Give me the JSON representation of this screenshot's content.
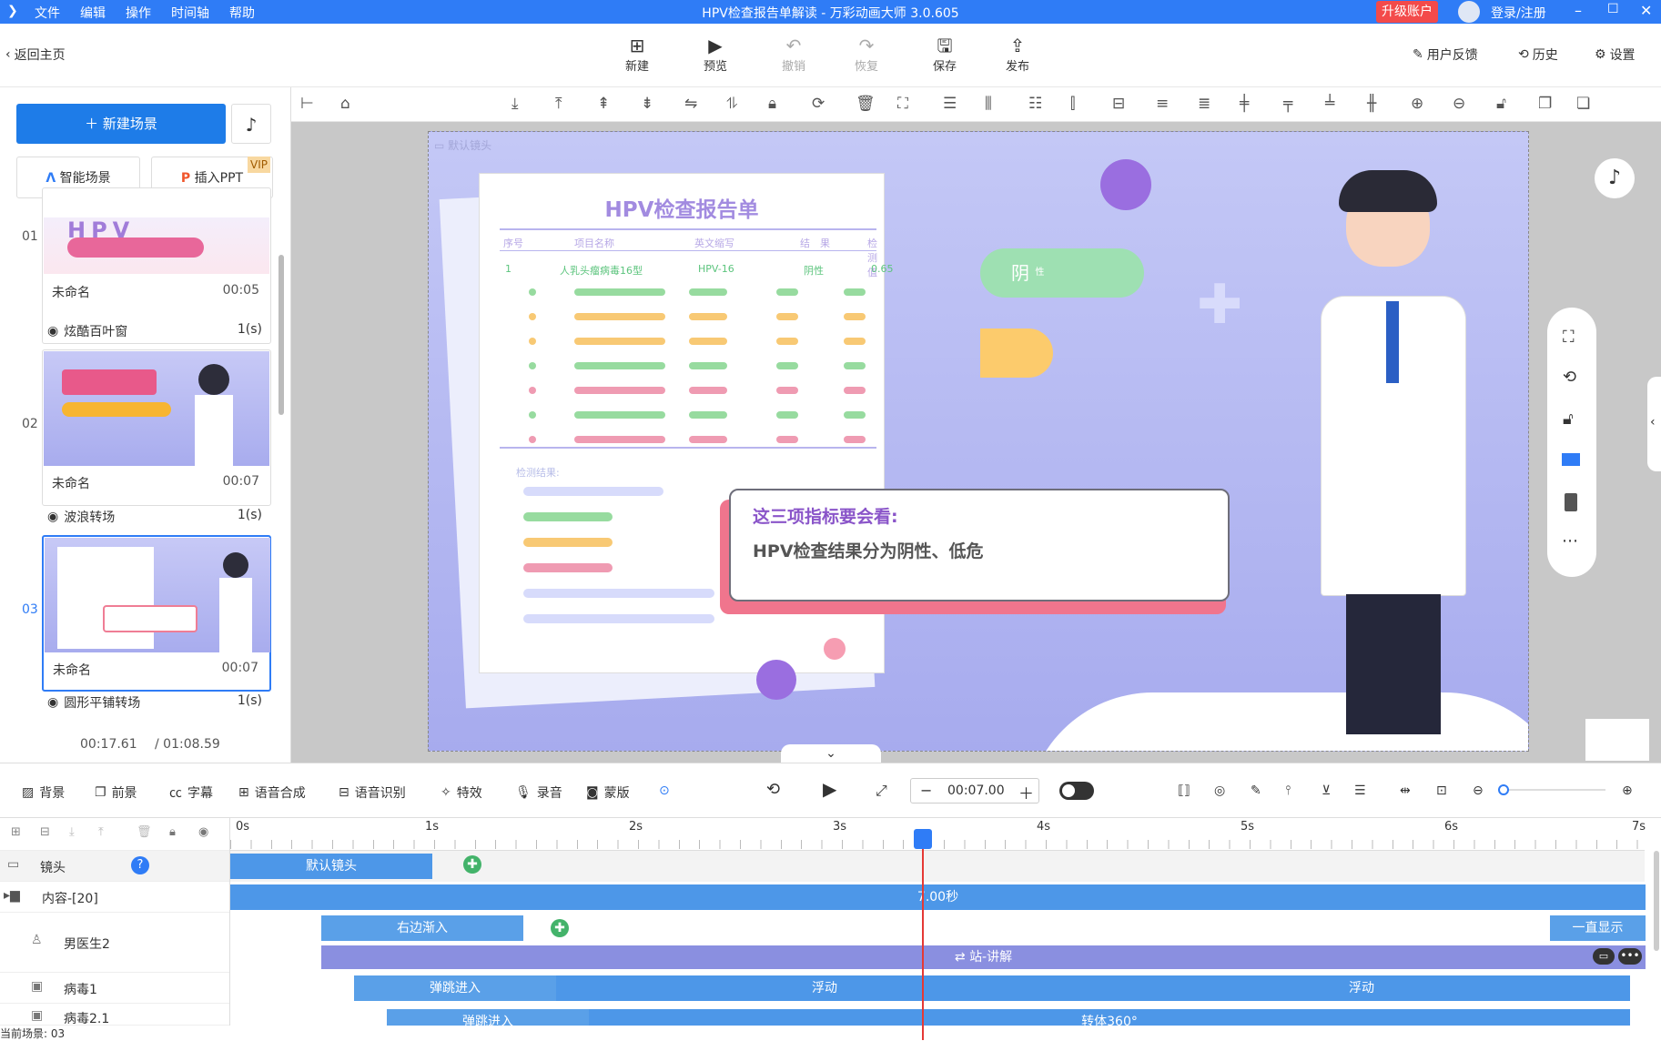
{
  "window": {
    "title": "HPV检查报告单解读 - 万彩动画大师 3.0.605",
    "menu": [
      "文件",
      "编辑",
      "操作",
      "时间轴",
      "帮助"
    ],
    "upgrade": "升级账户",
    "login": "登录/注册"
  },
  "toolbar": {
    "back": "返回主页",
    "new": "新建",
    "preview": "预览",
    "undo": "撤销",
    "redo": "恢复",
    "save": "保存",
    "publish": "发布",
    "feedback": "用户反馈",
    "history": "历史",
    "settings": "设置"
  },
  "left": {
    "new_scene": "新建场景",
    "smart_scene": "智能场景",
    "insert_ppt": "插入PPT",
    "vip": "VIP",
    "scenes": [
      {
        "num": "01",
        "name": "未命名",
        "duration": "00:05",
        "transition": "炫酷百叶窗",
        "trans_dur": "1(s)"
      },
      {
        "num": "02",
        "name": "未命名",
        "duration": "00:07",
        "transition": "波浪转场",
        "trans_dur": "1(s)"
      },
      {
        "num": "03",
        "name": "未命名",
        "duration": "00:07",
        "transition": "圆形平铺转场",
        "trans_dur": "1(s)"
      }
    ],
    "time_current": "00:17.61",
    "time_total": "/ 01:08.59"
  },
  "stage": {
    "camera_label": "默认镜头",
    "report_title": "HPV检查报告单",
    "headers": [
      "序号",
      "项目名称",
      "英文缩写",
      "结　果",
      "检测值"
    ],
    "row1": [
      "1",
      "人乳头瘤病毒16型",
      "HPV-16",
      "阴性",
      "0.65"
    ],
    "detect_label": "检测结果:",
    "negative": "阴",
    "negative_small": "性",
    "bubble_title": "这三项指标要会看:",
    "bubble_text": "HPV检查结果分为阴性、低危"
  },
  "timeline_toolbar": {
    "background": "背景",
    "foreground": "前景",
    "subtitle": "字幕",
    "tts": "语音合成",
    "asr": "语音识别",
    "effects": "特效",
    "record": "录音",
    "mask": "蒙版",
    "time": "00:07.00"
  },
  "ruler": [
    "0s",
    "1s",
    "2s",
    "3s",
    "4s",
    "5s",
    "6s",
    "7s"
  ],
  "tracks": {
    "camera": "镜头",
    "content": "内容-[20]",
    "doctor": "男医生2",
    "virus1": "病毒1",
    "virus2": "病毒2.1",
    "current_scene": "当前场景: 03"
  },
  "bars": {
    "default_camera": "默认镜头",
    "content_dur": "7.00秒",
    "doctor_in": "右边渐入",
    "doctor_show": "一直显示",
    "doctor_action": "站-讲解",
    "virus1_in": "弹跳进入",
    "virus1_float1": "浮动",
    "virus1_float2": "浮动",
    "virus2_in": "弹跳进入",
    "virus2_rot": "转体360°"
  },
  "colors": {
    "accent": "#2f7cf6",
    "bar": "#4d97e8",
    "action": "#8a8fe0",
    "upgrade": "#f34a4a"
  }
}
